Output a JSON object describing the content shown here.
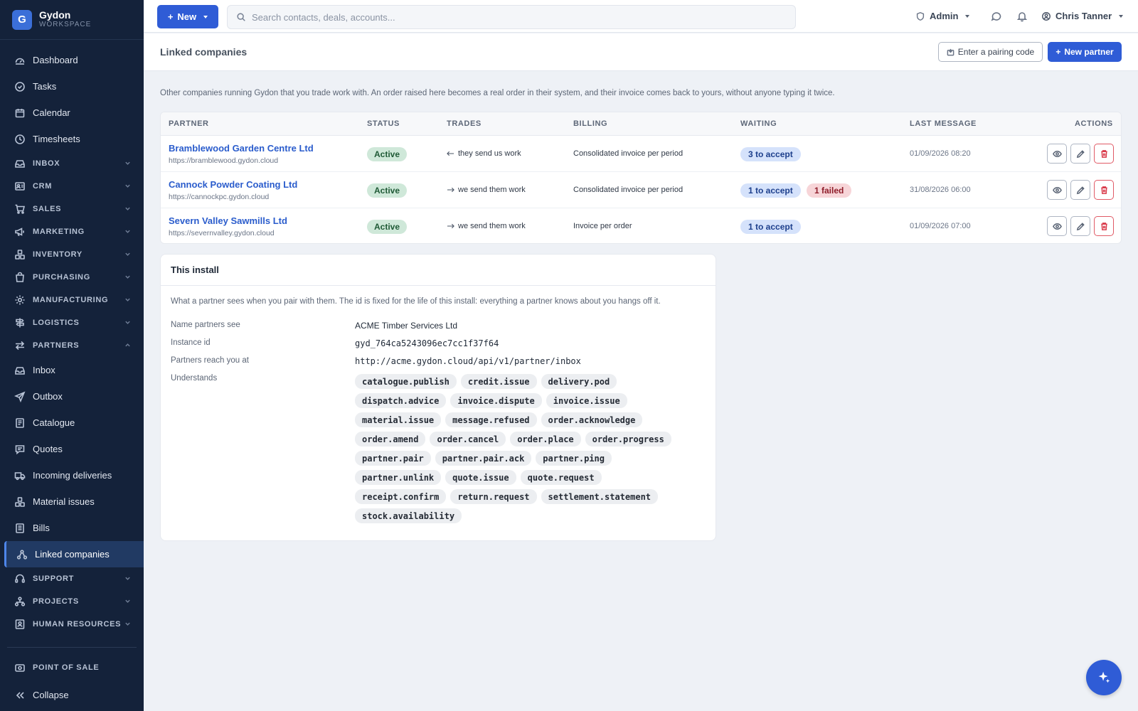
{
  "brand": {
    "letter": "G",
    "name": "Gydon",
    "sub": "WORKSPACE"
  },
  "nav_top": [
    {
      "label": "Dashboard",
      "icon": "dashboard-icon"
    },
    {
      "label": "Tasks",
      "icon": "tasks-icon"
    },
    {
      "label": "Calendar",
      "icon": "calendar-icon"
    },
    {
      "label": "Timesheets",
      "icon": "clock-icon"
    }
  ],
  "nav_sections": [
    {
      "label": "INBOX",
      "icon": "inbox-icon"
    },
    {
      "label": "CRM",
      "icon": "crm-icon"
    },
    {
      "label": "SALES",
      "icon": "cart-icon"
    },
    {
      "label": "MARKETING",
      "icon": "megaphone-icon"
    },
    {
      "label": "INVENTORY",
      "icon": "boxes-icon"
    },
    {
      "label": "PURCHASING",
      "icon": "bag-icon"
    },
    {
      "label": "MANUFACTURING",
      "icon": "cog-icon"
    },
    {
      "label": "LOGISTICS",
      "icon": "signpost-icon"
    },
    {
      "label": "PARTNERS",
      "icon": "arrows-icon"
    }
  ],
  "partners_items": [
    {
      "label": "Inbox",
      "icon": "inbox-icon"
    },
    {
      "label": "Outbox",
      "icon": "send-icon"
    },
    {
      "label": "Catalogue",
      "icon": "book-icon"
    },
    {
      "label": "Quotes",
      "icon": "quote-icon"
    },
    {
      "label": "Incoming deliveries",
      "icon": "truck-icon"
    },
    {
      "label": "Material issues",
      "icon": "boxes-icon"
    },
    {
      "label": "Bills",
      "icon": "bill-icon"
    },
    {
      "label": "Linked companies",
      "icon": "network-icon"
    }
  ],
  "nav_bottom_sections": [
    {
      "label": "SUPPORT",
      "icon": "headset-icon"
    },
    {
      "label": "PROJECTS",
      "icon": "projects-icon"
    },
    {
      "label": "HUMAN RESOURCES",
      "icon": "id-card-icon"
    }
  ],
  "pos_label": "POINT OF SALE",
  "collapse_label": "Collapse",
  "topbar": {
    "new_label": "New",
    "search_placeholder": "Search contacts, deals, accounts...",
    "admin_label": "Admin",
    "user_name": "Chris Tanner"
  },
  "page": {
    "title": "Linked companies",
    "pair_button": "Enter a pairing code",
    "new_partner_button": "New partner",
    "intro": "Other companies running Gydon that you trade work with. An order raised here becomes a real order in their system, and their invoice comes back to yours, without anyone typing it twice."
  },
  "table": {
    "headers": [
      "PARTNER",
      "STATUS",
      "TRADES",
      "BILLING",
      "WAITING",
      "LAST MESSAGE",
      "ACTIONS"
    ],
    "rows": [
      {
        "name": "Bramblewood Garden Centre Ltd",
        "url": "https://bramblewood.gydon.cloud",
        "status": "Active",
        "trades": "they send us work",
        "direction": "in",
        "billing": "Consolidated invoice per period",
        "waiting": "3 to accept",
        "failed": "",
        "last": "01/09/2026 08:20"
      },
      {
        "name": "Cannock Powder Coating Ltd",
        "url": "https://cannockpc.gydon.cloud",
        "status": "Active",
        "trades": "we send them work",
        "direction": "out",
        "billing": "Consolidated invoice per period",
        "waiting": "1 to accept",
        "failed": "1 failed",
        "last": "31/08/2026 06:00"
      },
      {
        "name": "Severn Valley Sawmills Ltd",
        "url": "https://severnvalley.gydon.cloud",
        "status": "Active",
        "trades": "we send them work",
        "direction": "out",
        "billing": "Invoice per order",
        "waiting": "1 to accept",
        "failed": "",
        "last": "01/09/2026 07:00"
      }
    ]
  },
  "install": {
    "title": "This install",
    "description": "What a partner sees when you pair with them. The id is fixed for the life of this install: everything a partner knows about you hangs off it.",
    "name_label": "Name partners see",
    "name_value": "ACME Timber Services Ltd",
    "id_label": "Instance id",
    "id_value": "gyd_764ca5243096ec7cc1f37f64",
    "reach_label": "Partners reach you at",
    "reach_value": "http://acme.gydon.cloud/api/v1/partner/inbox",
    "understands_label": "Understands",
    "understands": [
      "catalogue.publish",
      "credit.issue",
      "delivery.pod",
      "dispatch.advice",
      "invoice.dispute",
      "invoice.issue",
      "material.issue",
      "message.refused",
      "order.acknowledge",
      "order.amend",
      "order.cancel",
      "order.place",
      "order.progress",
      "partner.pair",
      "partner.pair.ack",
      "partner.ping",
      "partner.unlink",
      "quote.issue",
      "quote.request",
      "receipt.confirm",
      "return.request",
      "settlement.statement",
      "stock.availability"
    ]
  },
  "colors": {
    "primary": "#2f5cd6",
    "sidebar": "#14223a",
    "active_badge": "#cfe8d9",
    "waiting_pill": "#d5e2fb",
    "failed_pill": "#f7d5d8"
  }
}
